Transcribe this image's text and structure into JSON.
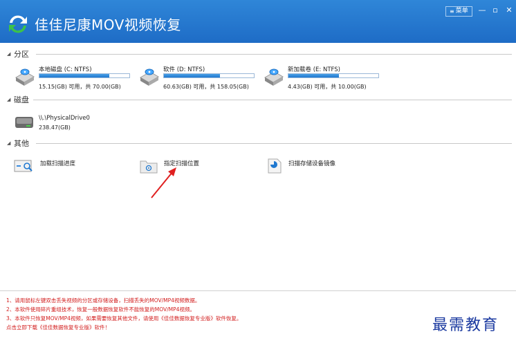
{
  "app": {
    "title": "佳佳尼康MOV视频恢复",
    "menu_label": "菜单",
    "minimize": "—",
    "restore": "▫",
    "close": "✕"
  },
  "sections": {
    "partitions": "分区",
    "disks": "磁盘",
    "others": "其他"
  },
  "partitions": [
    {
      "name": "本地磁盘 (C: NTFS)",
      "size": "15.15(GB) 可用，共 70.00(GB)",
      "used_fraction": 0.78
    },
    {
      "name": "软件 (D: NTFS)",
      "size": "60.63(GB) 可用，共 158.05(GB)",
      "used_fraction": 0.62
    },
    {
      "name": "新加载卷 (E: NTFS)",
      "size": "4.43(GB) 可用，共 10.00(GB)",
      "used_fraction": 0.56
    }
  ],
  "disk": {
    "name": "\\\\.\\PhysicalDrive0",
    "size": "238.47(GB)"
  },
  "tools": {
    "load_progress": "加载扫描进度",
    "scan_location": "指定扫描位置",
    "scan_image": "扫描存储设备镜像"
  },
  "notes": [
    "1、请用鼠标左键双击丢失视频的分区或存储设备，扫描丢失的MOV/MP4视频数据。",
    "2、本软件使用碎片重组技术，恢复一般数据恢复软件不能恢复的MOV/MP4视频。",
    "3、本软件只恢复MOV/MP4视频，如果需要恢复其他文件，请使用《佳佳数据恢复专业版》软件恢复。",
    "    点击立即下载《佳佳数据恢复专业版》软件！"
  ],
  "watermark": "最需教育",
  "colors": {
    "titlebar": "#1e6cc6",
    "progress": "#1f78d0",
    "note_text": "#d21c1c",
    "annotation_arrow": "#e02020"
  }
}
